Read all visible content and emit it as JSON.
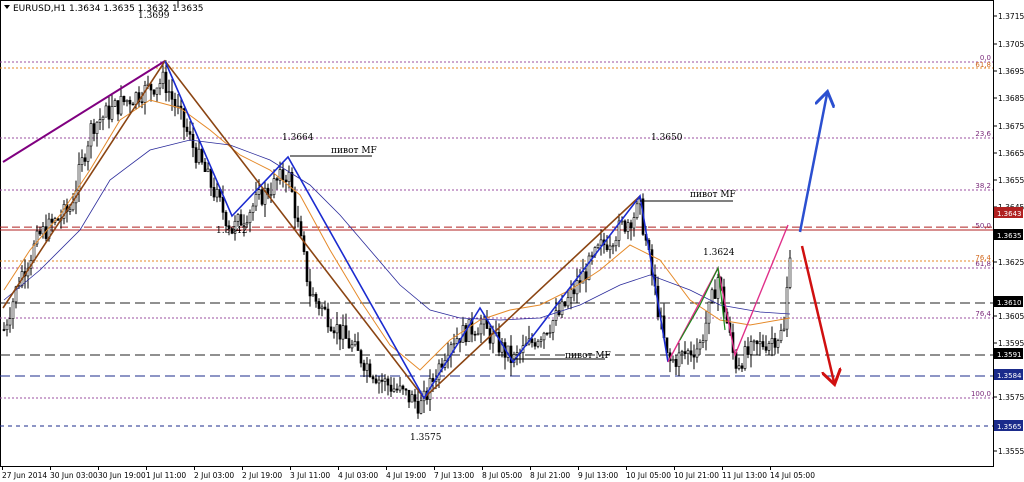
{
  "header": {
    "symbol_line": "EURUSD,H1  1.3634 1.3635 1.3632 1.3635"
  },
  "colors": {
    "candle": "#000000",
    "zigzag_blue": "#1b2bd0",
    "zigzag_brown": "#8b4513",
    "trend_purple": "#800080",
    "pink": "#e0308a",
    "green": "#1a8a1a",
    "ma_fast": "#e58a2a",
    "ma_slow": "#2b2b9b",
    "fib_purple": "#9b4fa0",
    "fib_orange": "#e58a2a",
    "arrow_up": "#2b4fd0",
    "arrow_down": "#d01010",
    "dash_red": "#b02020",
    "dash_black": "#222222",
    "dash_navy": "#1b2b8b"
  },
  "chart_data": {
    "type": "candlestick",
    "symbol": "EURUSD",
    "timeframe": "H1",
    "ohlc_header": {
      "open": 1.3634,
      "high": 1.3635,
      "low": 1.3632,
      "close": 1.3635
    },
    "ylim": [
      1.3552,
      1.3728
    ],
    "y_ticks": [
      "1.3715",
      "1.3705",
      "1.3695",
      "1.3685",
      "1.3675",
      "1.3665",
      "1.3655",
      "1.3645",
      "1.3625",
      "1.3605",
      "1.3595",
      "1.3575",
      "1.3555"
    ],
    "x_ticks": [
      "27 Jun 2014",
      "30 Jun 03:00",
      "30 Jun 19:00",
      "1 Jul 11:00",
      "2 Jul 03:00",
      "2 Jul 19:00",
      "3 Jul 11:00",
      "4 Jul 03:00",
      "4 Jul 19:00",
      "7 Jul 13:00",
      "8 Jul 05:00",
      "8 Jul 21:00",
      "9 Jul 13:00",
      "10 Jul 05:00",
      "10 Jul 21:00",
      "11 Jul 13:00",
      "14 Jul 05:00"
    ],
    "price_labels": [
      {
        "text": "1.3643",
        "bg": "#b02020",
        "fg": "#ffffff"
      },
      {
        "text": "1.3635",
        "bg": "#000000",
        "fg": "#ffffff"
      },
      {
        "text": "1.3610",
        "bg": "#000000",
        "fg": "#ffffff"
      },
      {
        "text": "1.3591",
        "bg": "#000000",
        "fg": "#ffffff"
      },
      {
        "text": "1.3584",
        "bg": "#1b2b8b",
        "fg": "#ffffff"
      },
      {
        "text": "1.3565",
        "bg": "#1b2b8b",
        "fg": "#ffffff"
      }
    ],
    "annotations": [
      "1.3699",
      "1.3664",
      "1.3642",
      "1.3650",
      "1.3624",
      "1.3575"
    ],
    "pivot_labels": [
      "пивот MF",
      "пивот MF",
      "пивот MF"
    ],
    "fib_levels_purple": [
      "0,0",
      "23,6",
      "38,2",
      "50,0",
      "61,8",
      "76,4",
      "100,0"
    ],
    "fib_levels_orange": [
      "61,8",
      "76,4"
    ],
    "levels": {
      "red_dashed": 1.3643,
      "close": 1.3635,
      "black_dashed_1": 1.361,
      "black_dashed_2": 1.3591,
      "navy_dashed_1": 1.3584,
      "navy_dashed_2": 1.3565
    }
  }
}
